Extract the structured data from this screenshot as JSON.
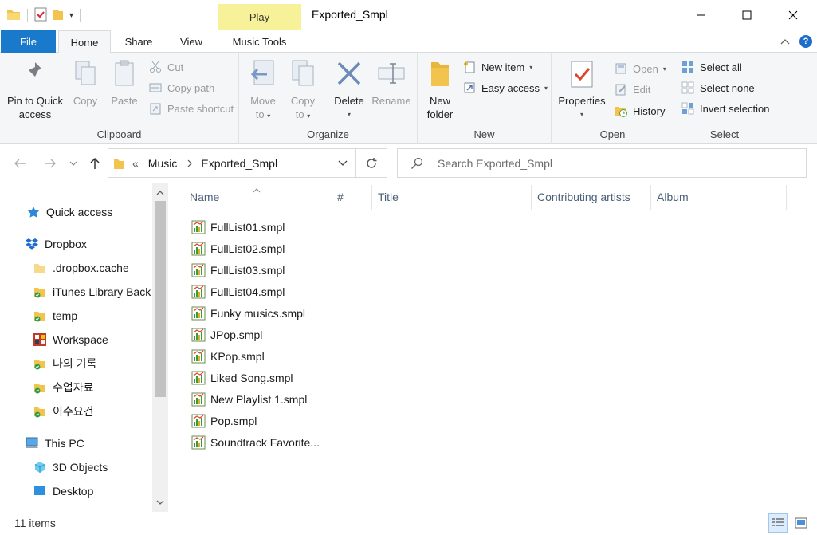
{
  "window": {
    "title": "Exported_Smpl",
    "contextual_tab": "Play",
    "minimize": "—",
    "maximize": "☐",
    "close": "✕"
  },
  "ribbon_tabs": {
    "file": "File",
    "home": "Home",
    "share": "Share",
    "view": "View",
    "music_tools": "Music Tools",
    "expand": "^",
    "help": "?"
  },
  "clipboard": {
    "label": "Clipboard",
    "pin_line1": "Pin to Quick",
    "pin_line2": "access",
    "copy": "Copy",
    "paste": "Paste",
    "cut": "Cut",
    "copy_path": "Copy path",
    "paste_shortcut": "Paste shortcut"
  },
  "organize": {
    "label": "Organize",
    "move_line1": "Move",
    "move_line2": "to",
    "copy_line1": "Copy",
    "copy_line2": "to",
    "delete": "Delete",
    "rename": "Rename"
  },
  "new_group": {
    "label": "New",
    "new_folder_line1": "New",
    "new_folder_line2": "folder",
    "new_item": "New item",
    "easy_access": "Easy access"
  },
  "open_group": {
    "label": "Open",
    "properties": "Properties",
    "open": "Open",
    "edit": "Edit",
    "history": "History"
  },
  "select_group": {
    "label": "Select",
    "select_all": "Select all",
    "select_none": "Select none",
    "invert": "Invert selection"
  },
  "address": {
    "chevrons": "«",
    "crumbs": [
      "Music",
      "Exported_Smpl"
    ],
    "search_placeholder": "Search Exported_Smpl"
  },
  "nav": {
    "items": [
      {
        "label": "Quick access"
      },
      {
        "label": "Dropbox"
      },
      {
        "label": ".dropbox.cache"
      },
      {
        "label": "iTunes Library Back"
      },
      {
        "label": "temp"
      },
      {
        "label": "Workspace"
      },
      {
        "label": "나의 기록"
      },
      {
        "label": "수업자료"
      },
      {
        "label": "이수요건"
      },
      {
        "label": "This PC"
      },
      {
        "label": "3D Objects"
      },
      {
        "label": "Desktop"
      }
    ]
  },
  "columns": {
    "name": "Name",
    "number": "#",
    "title": "Title",
    "contributing_artists": "Contributing artists",
    "album": "Album"
  },
  "files": [
    "FullList01.smpl",
    "FullList02.smpl",
    "FullList03.smpl",
    "FullList04.smpl",
    "Funky musics.smpl",
    "JPop.smpl",
    "KPop.smpl",
    "Liked Song.smpl",
    "New Playlist 1.smpl",
    "Pop.smpl",
    "Soundtrack Favorite..."
  ],
  "status": {
    "count": "11 items"
  },
  "colors": {
    "accent": "#1979ca",
    "contextual": "#f7f19a",
    "folder": "#f3c44d",
    "column_header": "#4c607a"
  }
}
